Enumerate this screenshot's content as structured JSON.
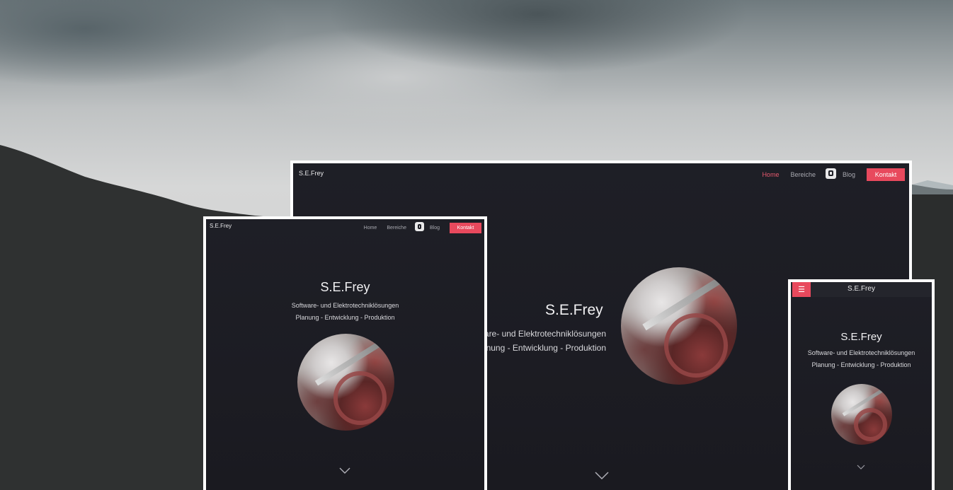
{
  "brand": "S.E.Frey",
  "nav": {
    "home": "Home",
    "areas": "Bereiche",
    "blog": "Blog",
    "contact": "Kontakt"
  },
  "hero": {
    "title": "S.E.Frey",
    "line1": "Software- und Elektrotechniklösungen",
    "line2": "Planung - Entwicklung - Produktion"
  },
  "large_hero": {
    "line1_visible": "are- und Elektrotechniklösungen",
    "line2_visible": "anung - Entwicklung - Produktion"
  },
  "icons": {
    "blog": "blogger-icon",
    "scroll": "chevron-down-icon",
    "menu": "hamburger-icon"
  },
  "colors": {
    "accent": "#e8495d",
    "screen_bg": "#1e1f26"
  }
}
